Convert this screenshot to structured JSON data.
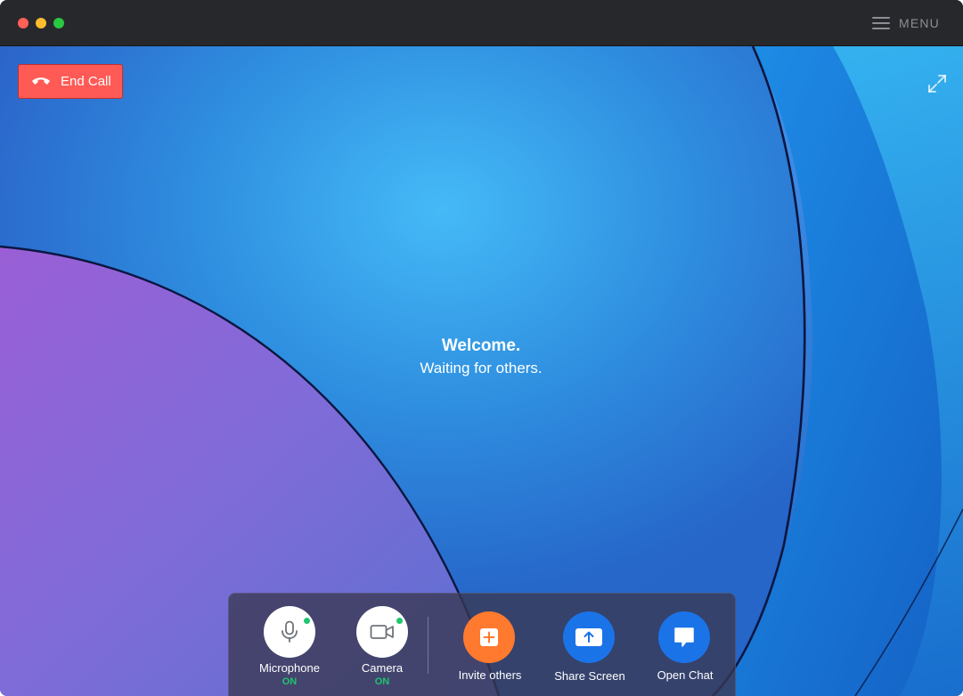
{
  "window": {
    "menu_label": "MENU"
  },
  "call": {
    "end_call_label": "End Call",
    "welcome_title": "Welcome.",
    "welcome_subtitle": "Waiting for others."
  },
  "controls": {
    "microphone": {
      "label": "Microphone",
      "status": "ON",
      "icon": "microphone-icon"
    },
    "camera": {
      "label": "Camera",
      "status": "ON",
      "icon": "video-camera-icon"
    },
    "invite": {
      "label": "Invite others",
      "icon": "plus-icon"
    },
    "share": {
      "label": "Share Screen",
      "icon": "share-screen-icon"
    },
    "chat": {
      "label": "Open Chat",
      "icon": "chat-bubble-icon"
    }
  },
  "colors": {
    "end_call": "#ff5a55",
    "invite": "#ff7a2e",
    "action_blue": "#1b73e8",
    "status_on": "#1fc56f"
  }
}
